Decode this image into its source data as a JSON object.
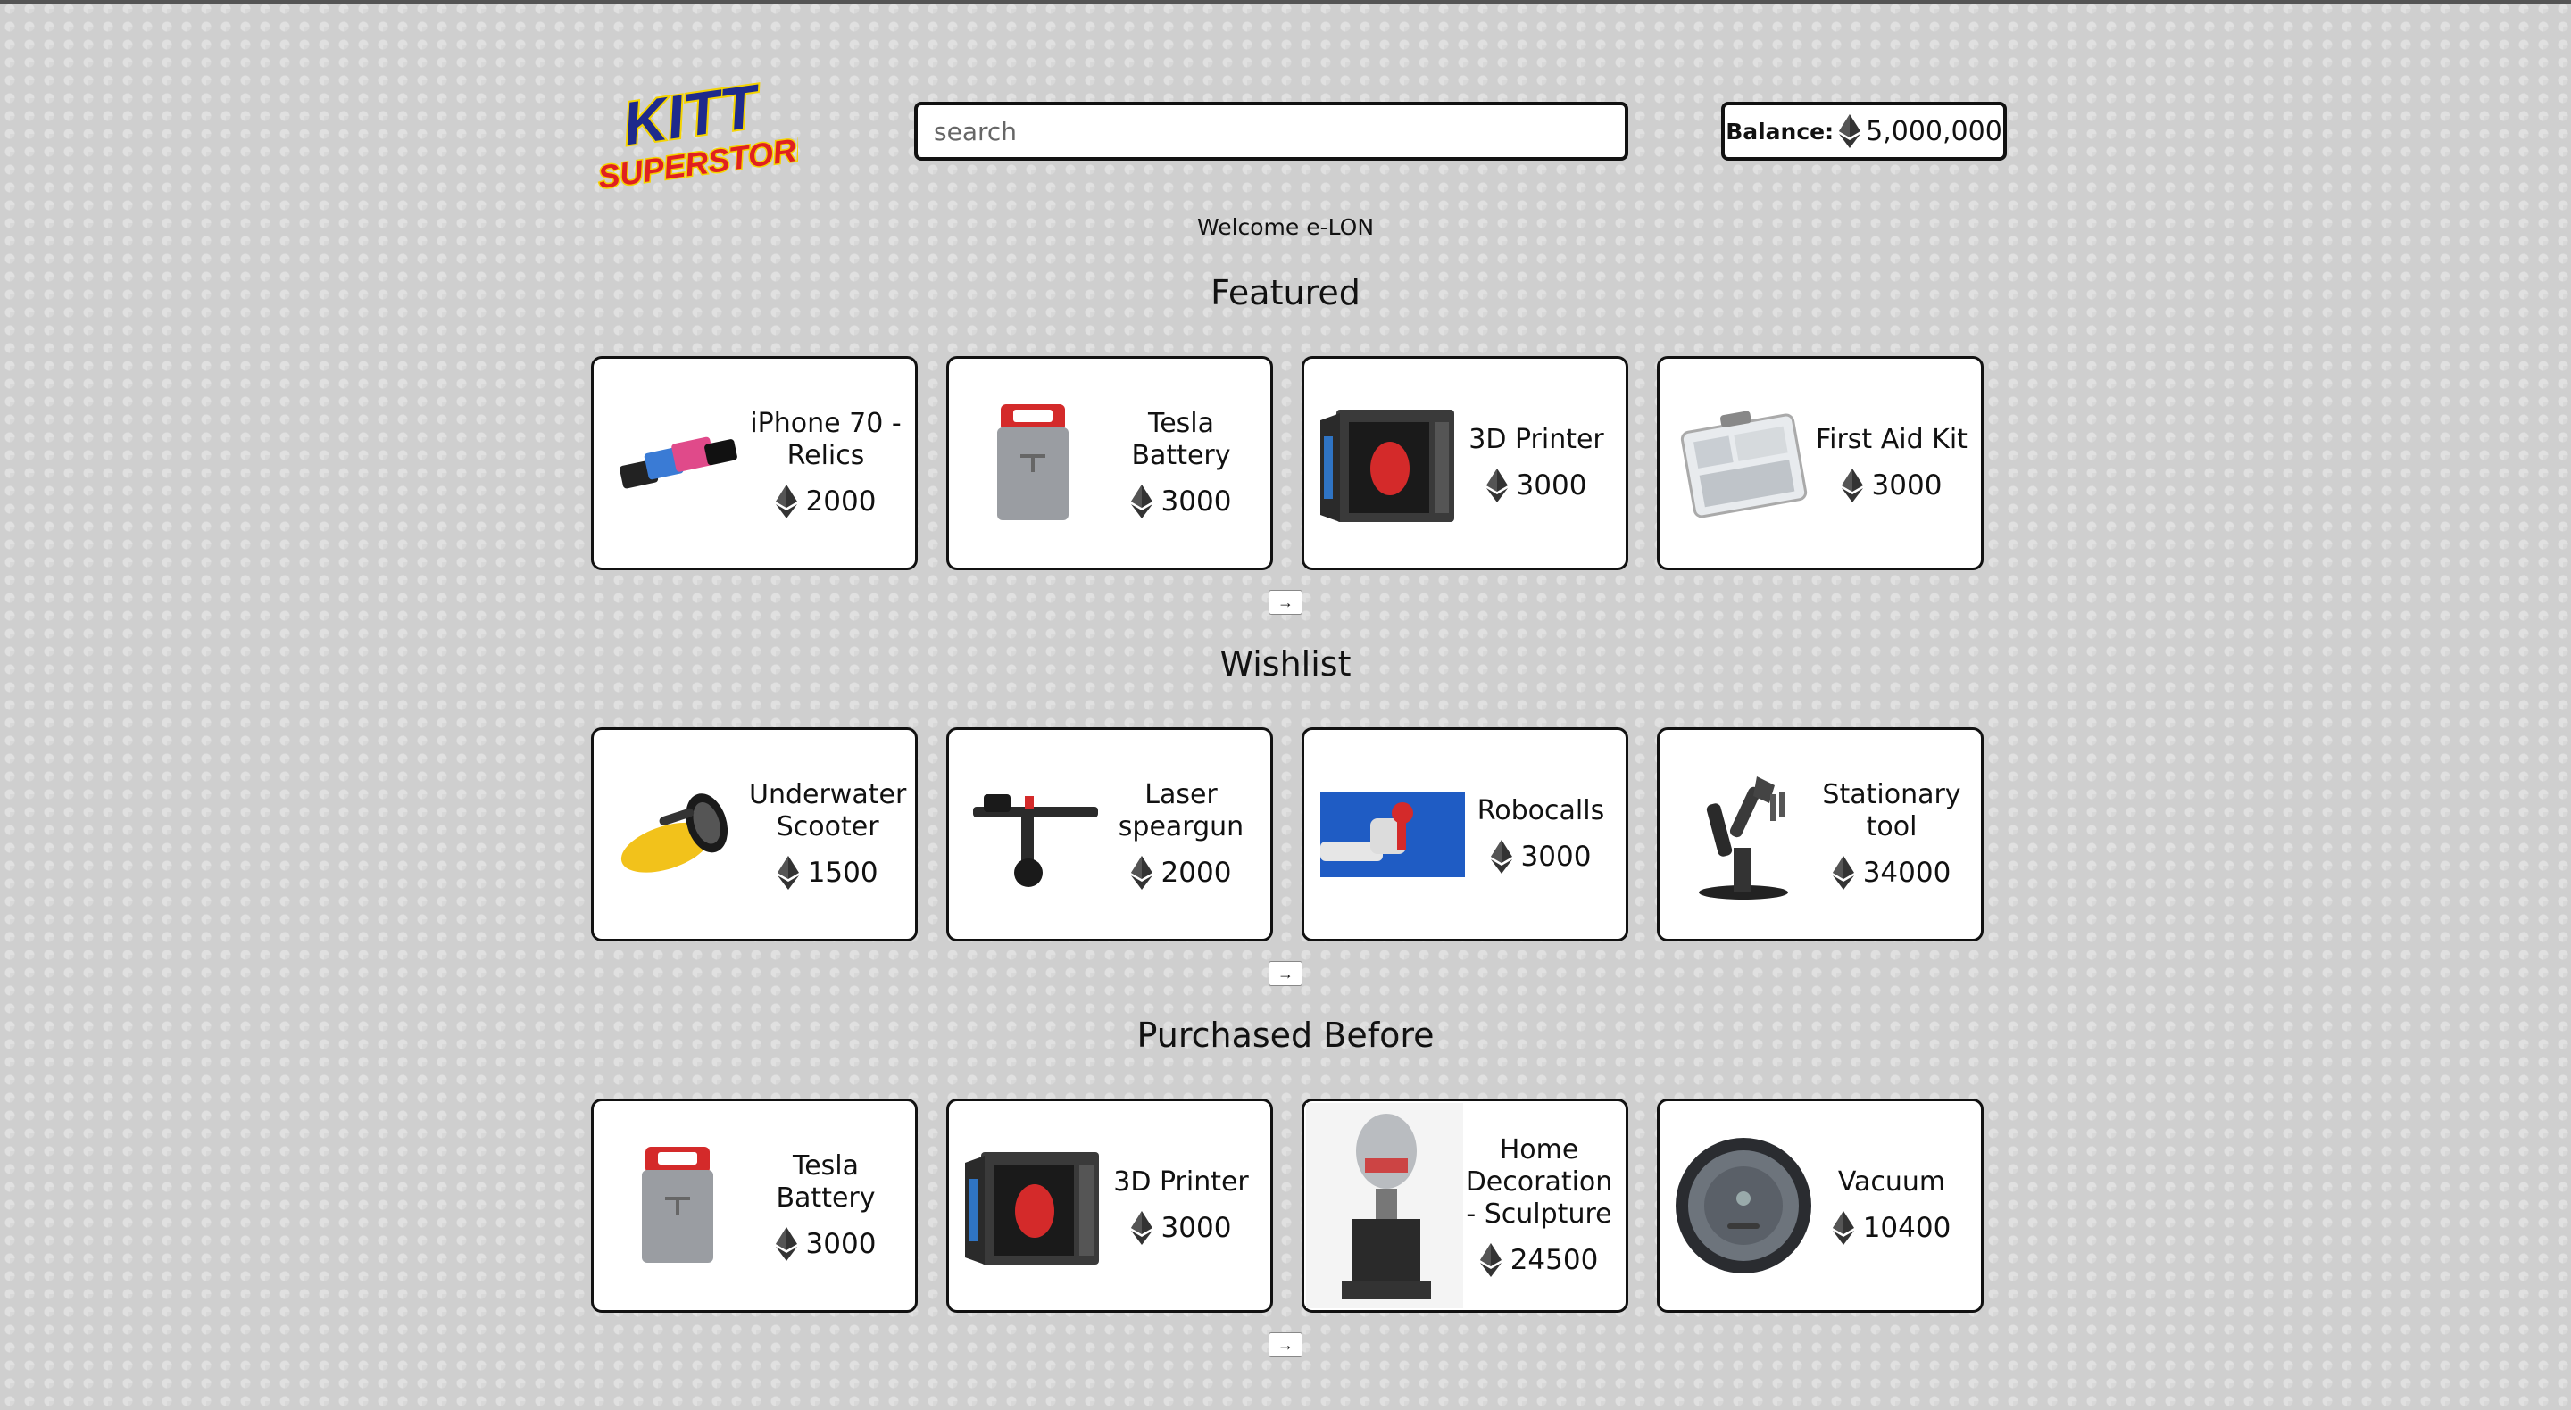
{
  "app": {
    "logo_line1": "KITT",
    "logo_line2": "SUPERSTORE"
  },
  "search": {
    "placeholder": "search",
    "value": ""
  },
  "balance": {
    "label": "Balance:",
    "value": "5,000,000",
    "icon": "ethereum-icon"
  },
  "welcome": "Welcome e-LON",
  "sections": {
    "featured": {
      "title": "Featured",
      "next_icon": "→",
      "items": [
        {
          "name": "iPhone 70 - Relics",
          "price": "2000",
          "image": "phone-image"
        },
        {
          "name": "Tesla Battery",
          "price": "3000",
          "image": "battery-image"
        },
        {
          "name": "3D Printer",
          "price": "3000",
          "image": "printer-image"
        },
        {
          "name": "First Aid Kit",
          "price": "3000",
          "image": "first-aid-kit-image"
        }
      ]
    },
    "wishlist": {
      "title": "Wishlist",
      "next_icon": "→",
      "items": [
        {
          "name": "Underwater Scooter",
          "price": "1500",
          "image": "scooter-image"
        },
        {
          "name": "Laser speargun",
          "price": "2000",
          "image": "speargun-image"
        },
        {
          "name": "Robocalls",
          "price": "3000",
          "image": "robot-hand-phone-image"
        },
        {
          "name": "Stationary tool",
          "price": "34000",
          "image": "robot-arm-image"
        }
      ]
    },
    "purchased": {
      "title": "Purchased Before",
      "next_icon": "→",
      "items": [
        {
          "name": "Tesla Battery",
          "price": "3000",
          "image": "battery-image"
        },
        {
          "name": "3D Printer",
          "price": "3000",
          "image": "printer-image"
        },
        {
          "name": "Home Decoration - Sculpture",
          "price": "24500",
          "image": "robot-sculpture-image"
        },
        {
          "name": "Vacuum",
          "price": "10400",
          "image": "vacuum-image"
        }
      ]
    }
  },
  "colors": {
    "logo_blue": "#1e2a8c",
    "logo_red": "#e02020",
    "logo_yellow": "#f5d400",
    "accent_red": "#d42a2a"
  }
}
